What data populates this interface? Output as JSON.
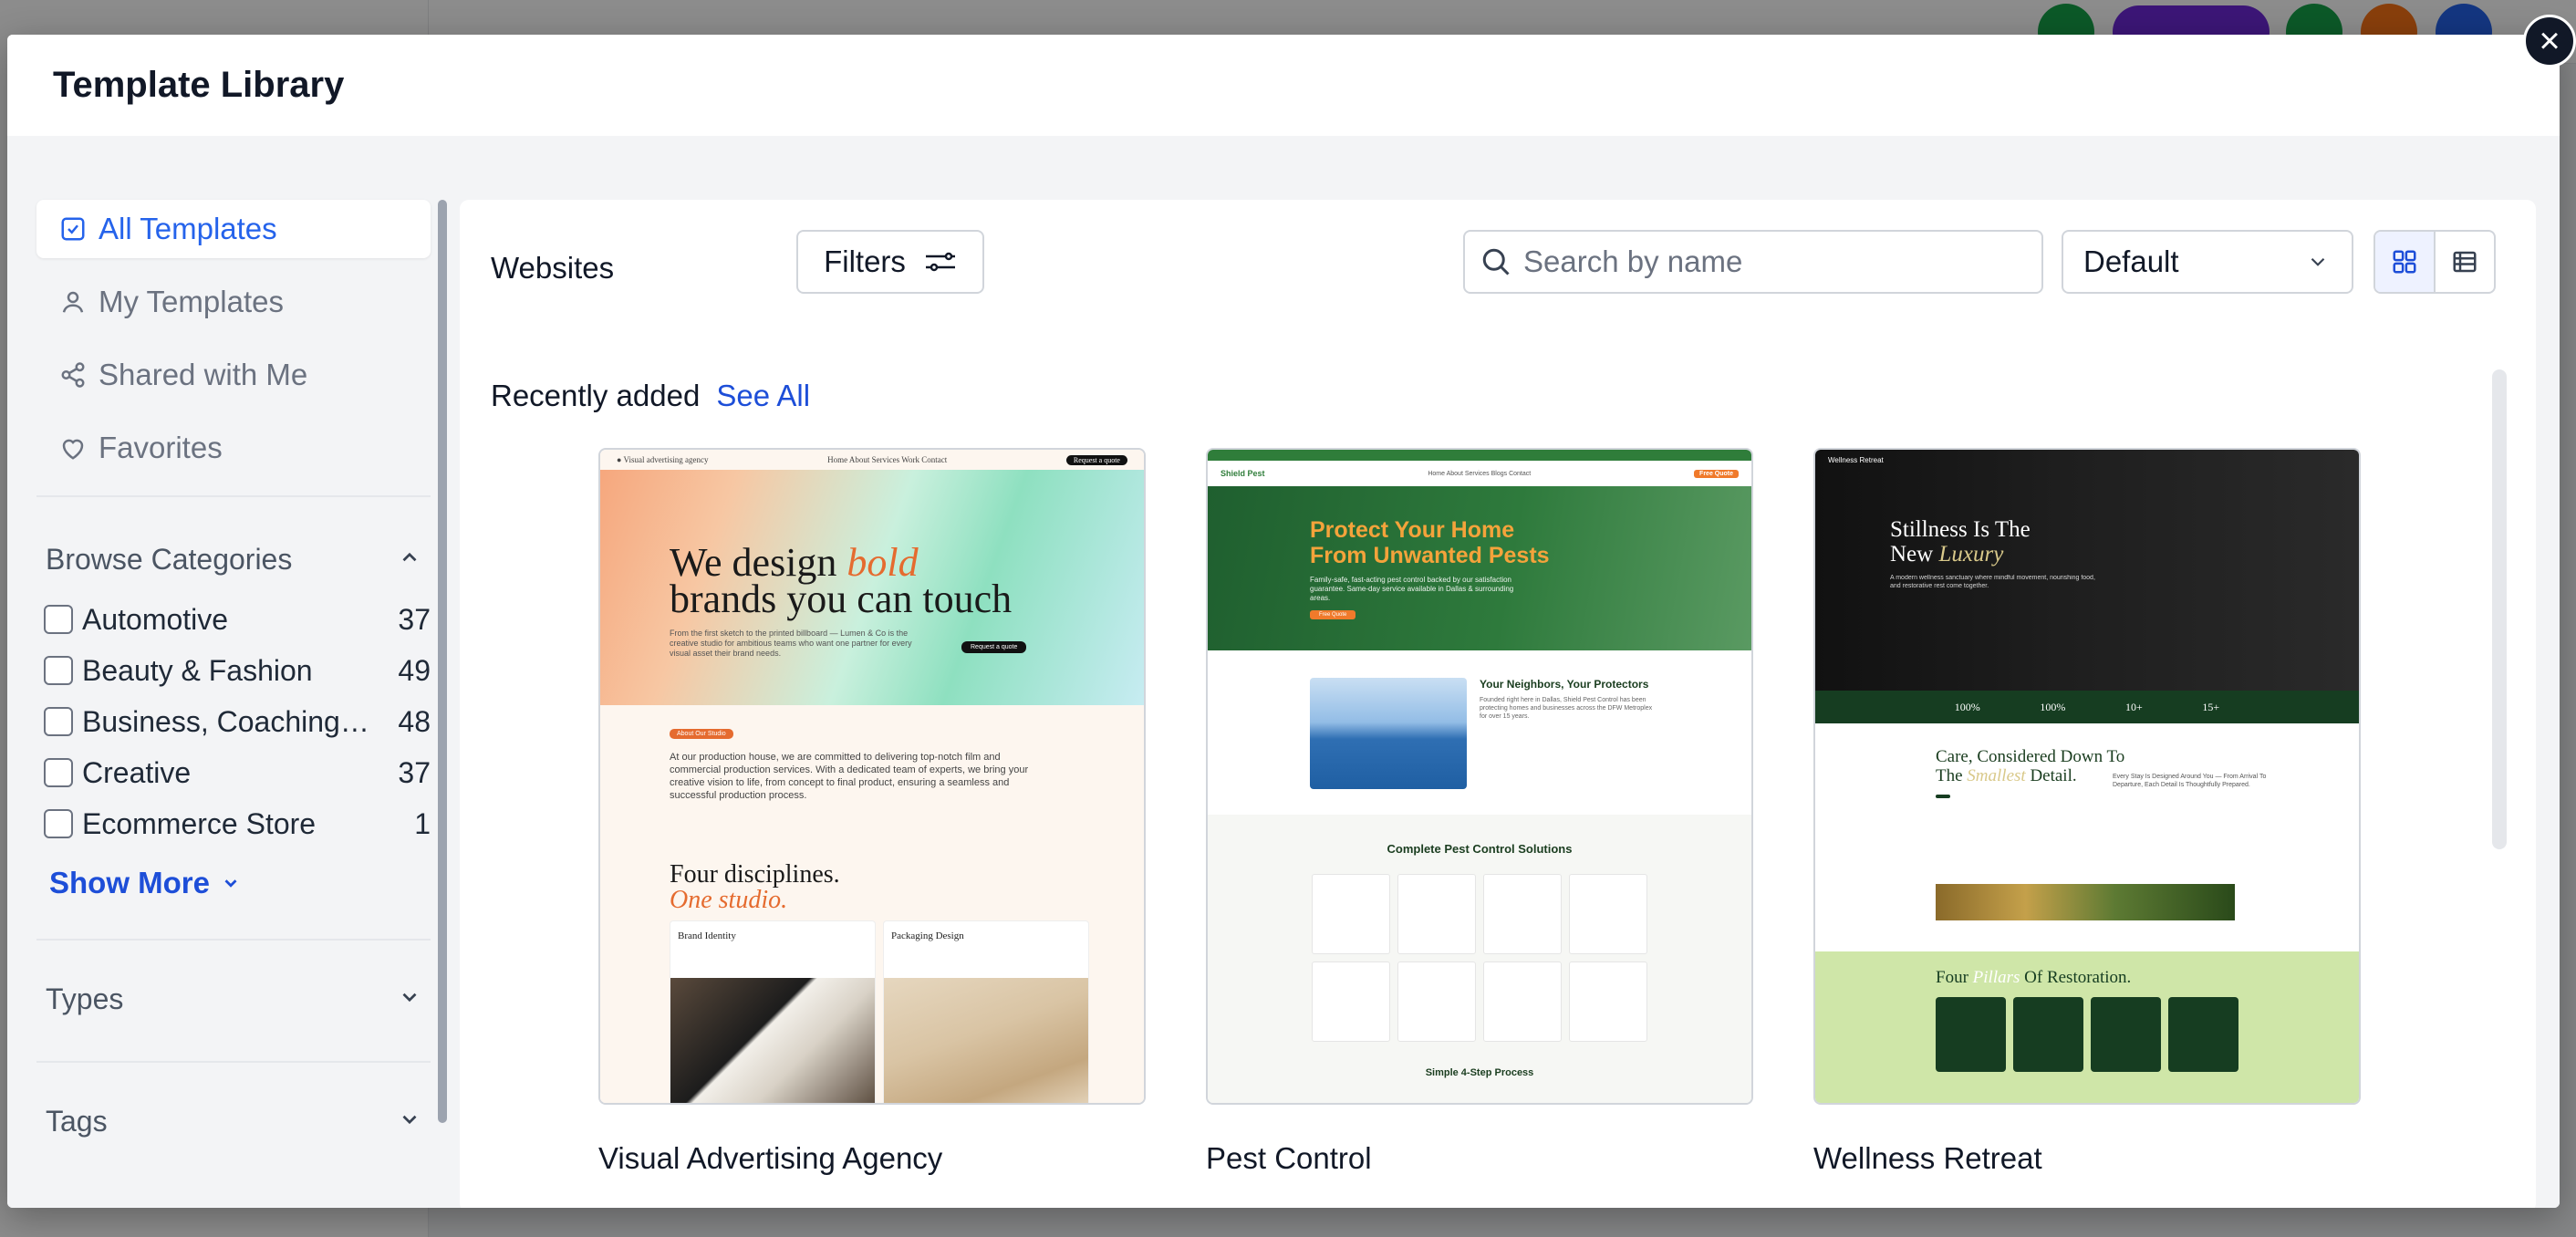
{
  "modal": {
    "title": "Template Library",
    "close_label": "×"
  },
  "sidebar": {
    "nav": [
      {
        "label": "All Templates",
        "icon": "checkbox-icon",
        "active": true
      },
      {
        "label": "My Templates",
        "icon": "user-icon",
        "active": false
      },
      {
        "label": "Shared with Me",
        "icon": "share-icon",
        "active": false
      },
      {
        "label": "Favorites",
        "icon": "heart-icon",
        "active": false
      }
    ],
    "browse_categories": {
      "title": "Browse Categories",
      "items": [
        {
          "label": "Automotive",
          "count": "37"
        },
        {
          "label": "Beauty & Fashion",
          "count": "49"
        },
        {
          "label": "Business, Coaching & Consulting",
          "count": "48"
        },
        {
          "label": "Creative",
          "count": "37"
        },
        {
          "label": "Ecommerce Store",
          "count": "1"
        }
      ],
      "show_more": "Show More"
    },
    "types_title": "Types",
    "tags_title": "Tags"
  },
  "main": {
    "section_title": "Websites",
    "filters_label": "Filters",
    "search": {
      "placeholder": "Search by name",
      "value": ""
    },
    "sort": {
      "selected": "Default"
    },
    "recent": {
      "label": "Recently added",
      "see_all": "See All"
    },
    "cards": [
      {
        "name": "Visual Advertising Agency",
        "preview": {
          "logo": "● Visual advertising agency",
          "nav": "Home   About   Services   Work   Contact",
          "cta": "Request a quote",
          "headline_a": "We design",
          "headline_em": "bold",
          "headline_b": "brands you can touch",
          "intro": "From the first sketch to the printed billboard — Lumen & Co is the creative studio for ambitious teams who want one partner for every visual asset their brand needs.",
          "badge": "About Our Studio",
          "about": "At our production house, we are committed to delivering top-notch film and commercial production services. With a dedicated team of experts, we bring your creative vision to life, from concept to final product, ensuring a seamless and successful production process.",
          "h2_a": "Four disciplines.",
          "h2_em": "One studio.",
          "tile1": "Brand Identity",
          "tile2": "Packaging Design"
        }
      },
      {
        "name": "Pest Control",
        "preview": {
          "logo": "Shield Pest",
          "nav": "Home  About  Services  Blogs  Contact",
          "cta": "Free Quote",
          "headline_a": "Protect Your Home",
          "headline_b": "From",
          "headline_em": "Unwanted Pests",
          "intro": "Family-safe, fast-acting pest control backed by our satisfaction guarantee. Same-day service available in Dallas & surrounding areas.",
          "button": "Free Quote",
          "sec_title": "Your Neighbors, Your Protectors",
          "sec_text": "Founded right here in Dallas, Shield Pest Control has been protecting homes and businesses across the DFW Metroplex for over 15 years.",
          "grid_title": "Complete Pest Control Solutions",
          "bottom_title": "Simple 4-Step Process"
        }
      },
      {
        "name": "Wellness Retreat",
        "preview": {
          "logo": "Wellness Retreat",
          "headline_a": "Stillness Is The",
          "headline_b": "New",
          "headline_em": "Luxury",
          "intro": "A modern wellness sanctuary where mindful movement, nourishing food, and restorative rest come together.",
          "stats": [
            "100%",
            "100%",
            "10+",
            "15+"
          ],
          "care_a": "Care, Considered Down To",
          "care_b": "The",
          "care_em": "Smallest",
          "care_c": "Detail.",
          "care_side": "Every Stay Is Designed Around You — From Arrival To Departure, Each Detail Is Thoughtfully Prepared.",
          "green_a": "Four",
          "green_em": "Pillars",
          "green_b": "Of Restoration."
        }
      }
    ]
  },
  "colors": {
    "accent": "#2563eb",
    "link": "#1d4ed8",
    "modal_bg": "#ffffff",
    "body_bg": "#f3f4f6"
  }
}
